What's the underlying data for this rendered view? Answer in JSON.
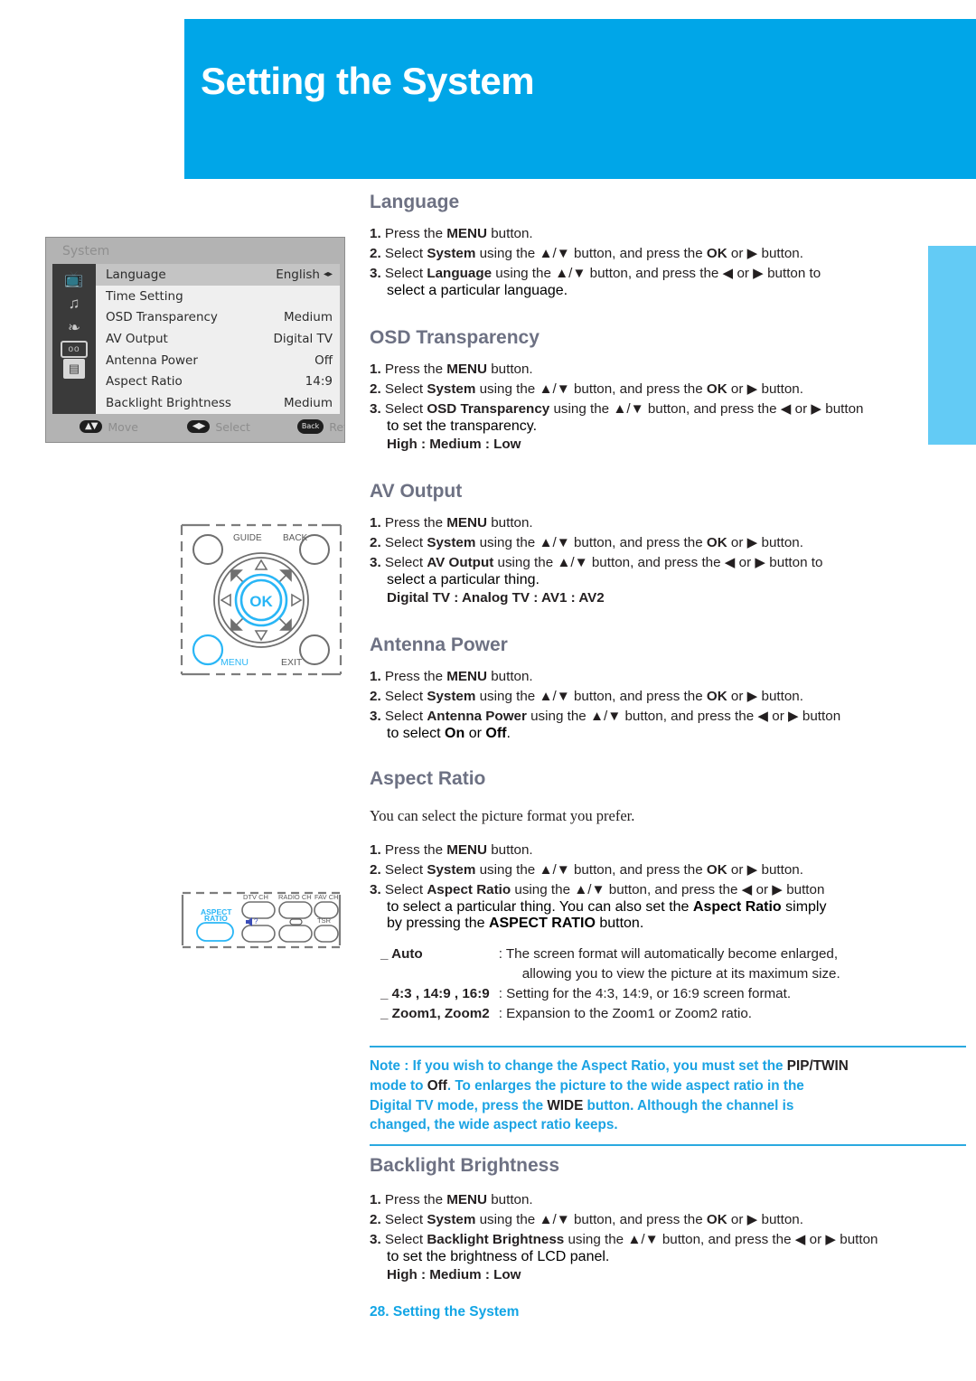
{
  "page": {
    "header_title": "Setting the System",
    "footer": "28. Setting the System",
    "accent_blue": "#00a6e8",
    "light_blue": "#63cbf5",
    "heading_color": "#6d7183",
    "note_color": "#1ba3e3"
  },
  "osd": {
    "title": "System",
    "rows": [
      {
        "label": "Language",
        "value": "English",
        "arrows": "◂▸",
        "selected": true
      },
      {
        "label": "Time Setting",
        "value": "",
        "arrows": "",
        "selected": false
      },
      {
        "label": "OSD Transparency",
        "value": "Medium",
        "arrows": "",
        "selected": false
      },
      {
        "label": "AV Output",
        "value": "Digital TV",
        "arrows": "",
        "selected": false
      },
      {
        "label": "Antenna Power",
        "value": "Off",
        "arrows": "",
        "selected": false
      },
      {
        "label": "Aspect Ratio",
        "value": "14:9",
        "arrows": "",
        "selected": false
      },
      {
        "label": "Backlight Brightness",
        "value": "Medium",
        "arrows": "",
        "selected": false
      }
    ],
    "icons": [
      "tv-icon",
      "music-note-icon",
      "ribbon-icon",
      "connector-icon",
      "tape-icon"
    ],
    "footer": {
      "move_badge": "▲▼",
      "move_label": "Move",
      "select_badge": "◀▶",
      "select_label": "Select",
      "return_badge": "Back",
      "return_label": "Return"
    }
  },
  "remote_nav": {
    "guide_label": "GUIDE",
    "back_label": "BACK",
    "menu_label": "MENU",
    "exit_label": "EXIT",
    "ok_label": "OK"
  },
  "remote_aspect": {
    "aspect_label_line1": "ASPECT",
    "aspect_label_line2": "RATIO",
    "dtv_ch_label": "DTV CH",
    "radio_ch_label": "RADIO CH",
    "fav_ch_label": "FAV CH",
    "mute_label": "?",
    "tsr_label": "TSR"
  },
  "sections": {
    "language": {
      "title": "Language",
      "steps": [
        {
          "num": "1.",
          "parts": [
            {
              "t": "Press the ",
              "b": false
            },
            {
              "t": "MENU",
              "b": true
            },
            {
              "t": " button.",
              "b": false
            }
          ]
        },
        {
          "num": "2.",
          "parts": [
            {
              "t": "Select ",
              "b": false
            },
            {
              "t": "System",
              "b": true
            },
            {
              "t": " using the ▲/▼ button, and press the ",
              "b": false
            },
            {
              "t": "OK",
              "b": true
            },
            {
              "t": " or ▶ button.",
              "b": false
            }
          ]
        },
        {
          "num": "3.",
          "parts": [
            {
              "t": "Select ",
              "b": false
            },
            {
              "t": "Language",
              "b": true
            },
            {
              "t": " using the ▲/▼ button, and press the ◀ or ▶ button to",
              "b": false
            }
          ]
        }
      ],
      "continuation": "select a particular language.",
      "values": ""
    },
    "osd_transparency": {
      "title": "OSD Transparency",
      "steps": [
        {
          "num": "1.",
          "parts": [
            {
              "t": "Press the ",
              "b": false
            },
            {
              "t": "MENU",
              "b": true
            },
            {
              "t": " button.",
              "b": false
            }
          ]
        },
        {
          "num": "2.",
          "parts": [
            {
              "t": "Select ",
              "b": false
            },
            {
              "t": "System",
              "b": true
            },
            {
              "t": " using the ▲/▼ button, and press the ",
              "b": false
            },
            {
              "t": "OK",
              "b": true
            },
            {
              "t": " or ▶ button.",
              "b": false
            }
          ]
        },
        {
          "num": "3.",
          "parts": [
            {
              "t": "Select ",
              "b": false
            },
            {
              "t": "OSD Transparency",
              "b": true
            },
            {
              "t": " using the ▲/▼ button, and press the ◀ or ▶ button",
              "b": false
            }
          ]
        }
      ],
      "continuation": "to set the transparency.",
      "values": "High : Medium : Low"
    },
    "av_output": {
      "title": "AV Output",
      "steps": [
        {
          "num": "1.",
          "parts": [
            {
              "t": "Press the ",
              "b": false
            },
            {
              "t": "MENU",
              "b": true
            },
            {
              "t": " button.",
              "b": false
            }
          ]
        },
        {
          "num": "2.",
          "parts": [
            {
              "t": "Select ",
              "b": false
            },
            {
              "t": "System",
              "b": true
            },
            {
              "t": " using the ▲/▼ button, and press the ",
              "b": false
            },
            {
              "t": "OK",
              "b": true
            },
            {
              "t": " or ▶ button.",
              "b": false
            }
          ]
        },
        {
          "num": "3.",
          "parts": [
            {
              "t": "Select ",
              "b": false
            },
            {
              "t": "AV Output",
              "b": true
            },
            {
              "t": " using the ▲/▼ button, and press the ◀ or ▶ button to",
              "b": false
            }
          ]
        }
      ],
      "continuation": "select a particular thing.",
      "values": "Digital TV : Analog TV : AV1 : AV2"
    },
    "antenna_power": {
      "title": "Antenna Power",
      "steps": [
        {
          "num": "1.",
          "parts": [
            {
              "t": "Press the ",
              "b": false
            },
            {
              "t": "MENU",
              "b": true
            },
            {
              "t": " button.",
              "b": false
            }
          ]
        },
        {
          "num": "2.",
          "parts": [
            {
              "t": "Select ",
              "b": false
            },
            {
              "t": "System",
              "b": true
            },
            {
              "t": " using the ▲/▼ button, and press the ",
              "b": false
            },
            {
              "t": "OK",
              "b": true
            },
            {
              "t": " or ▶ button.",
              "b": false
            }
          ]
        },
        {
          "num": "3.",
          "parts": [
            {
              "t": "Select ",
              "b": false
            },
            {
              "t": "Antenna Power",
              "b": true
            },
            {
              "t": " using the ▲/▼ button, and press the ◀ or ▶ button",
              "b": false
            }
          ]
        }
      ],
      "continuation_parts": [
        {
          "t": "to select ",
          "b": false
        },
        {
          "t": "On",
          "b": true
        },
        {
          "t": " or ",
          "b": false
        },
        {
          "t": "Off",
          "b": true
        },
        {
          "t": ".",
          "b": false
        }
      ],
      "values": ""
    },
    "aspect_ratio": {
      "title": "Aspect Ratio",
      "intro": "You can select the picture format you prefer.",
      "steps": [
        {
          "num": "1.",
          "parts": [
            {
              "t": "Press the ",
              "b": false
            },
            {
              "t": "MENU",
              "b": true
            },
            {
              "t": " button.",
              "b": false
            }
          ]
        },
        {
          "num": "2.",
          "parts": [
            {
              "t": "Select ",
              "b": false
            },
            {
              "t": "System",
              "b": true
            },
            {
              "t": " using the ▲/▼ button, and press the ",
              "b": false
            },
            {
              "t": "OK",
              "b": true
            },
            {
              "t": " or ▶ button.",
              "b": false
            }
          ]
        },
        {
          "num": "3.",
          "parts": [
            {
              "t": "Select ",
              "b": false
            },
            {
              "t": "Aspect Ratio",
              "b": true
            },
            {
              "t": " using the ▲/▼ button, and press the ◀ or ▶ button",
              "b": false
            }
          ]
        }
      ],
      "continuation_parts": [
        {
          "t": "to select a particular thing. You can also set the ",
          "b": false
        },
        {
          "t": "Aspect Ratio",
          "b": true
        },
        {
          "t": " simply",
          "b": false
        }
      ],
      "continuation2_parts": [
        {
          "t": "by pressing the ",
          "b": false
        },
        {
          "t": "ASPECT RATIO",
          "b": true
        },
        {
          "t": " button.",
          "b": false
        }
      ],
      "options": [
        {
          "key": "_ Auto",
          "desc": ": The screen format will automatically become enlarged,",
          "desc2": "allowing you to view the picture at its maximum size."
        },
        {
          "key": "_ 4:3 , 14:9 , 16:9",
          "desc": ": Setting for the 4:3, 14:9, or 16:9 screen format.",
          "desc2": ""
        },
        {
          "key": "_ Zoom1, Zoom2",
          "desc": ": Expansion to the Zoom1 or Zoom2 ratio.",
          "desc2": ""
        }
      ]
    },
    "note": {
      "line1": [
        {
          "t": "Note : If you wish to change the Aspect Ratio, you must set the ",
          "dark": false
        },
        {
          "t": "PIP/TWIN",
          "dark": true
        }
      ],
      "line2": [
        {
          "t": "mode to ",
          "dark": false
        },
        {
          "t": "Off",
          "dark": true
        },
        {
          "t": ". To enlarges the picture to the wide aspect ratio in the",
          "dark": false
        }
      ],
      "line3": [
        {
          "t": "Digital TV mode, press the ",
          "dark": false
        },
        {
          "t": "WIDE",
          "dark": true
        },
        {
          "t": " button. Although the channel is",
          "dark": false
        }
      ],
      "line4": [
        {
          "t": "changed, the wide aspect ratio keeps.",
          "dark": false
        }
      ]
    },
    "backlight_brightness": {
      "title": "Backlight Brightness",
      "steps": [
        {
          "num": "1.",
          "parts": [
            {
              "t": "Press the ",
              "b": false
            },
            {
              "t": "MENU",
              "b": true
            },
            {
              "t": " button.",
              "b": false
            }
          ]
        },
        {
          "num": "2.",
          "parts": [
            {
              "t": "Select ",
              "b": false
            },
            {
              "t": "System",
              "b": true
            },
            {
              "t": " using the ▲/▼ button, and press the ",
              "b": false
            },
            {
              "t": "OK",
              "b": true
            },
            {
              "t": " or ▶ button.",
              "b": false
            }
          ]
        },
        {
          "num": "3.",
          "parts": [
            {
              "t": "Select ",
              "b": false
            },
            {
              "t": "Backlight Brightness",
              "b": true
            },
            {
              "t": " using the ▲/▼ button, and press the ◀ or ▶ button",
              "b": false
            }
          ]
        }
      ],
      "continuation": "to set the brightness of LCD panel.",
      "values": "High : Medium : Low"
    }
  }
}
